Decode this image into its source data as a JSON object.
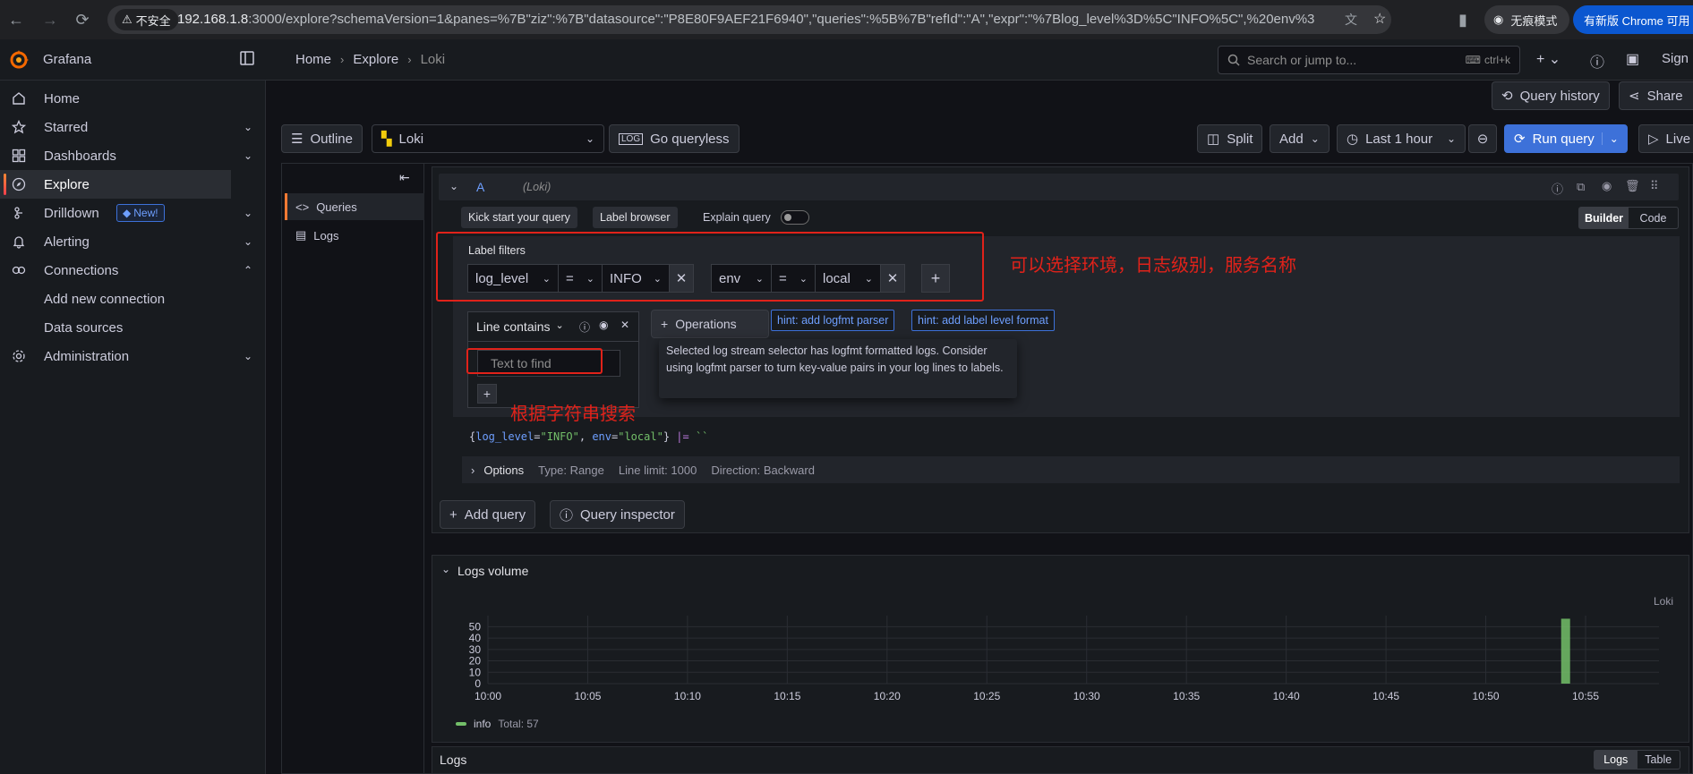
{
  "browser": {
    "insecure_label": "不安全",
    "url_host": "192.168.1.8",
    "url_rest": ":3000/explore?schemaVersion=1&panes=%7B\"ziz\":%7B\"datasource\":\"P8E80F9AEF21F6940\",\"queries\":%5B%7B\"refId\":\"A\",\"expr\":\"%7Blog_level%3D%5C\"INFO%5C\",%20env%3D%5C\"local...",
    "incognito_label": "无痕模式",
    "update_label": "有新版 Chrome 可用"
  },
  "topbar": {
    "brand": "Grafana",
    "breadcrumbs": [
      "Home",
      "Explore",
      "Loki"
    ],
    "search_placeholder": "Search or jump to...",
    "search_shortcut": "ctrl+k",
    "sign_in": "Sign"
  },
  "sidebar": {
    "items": [
      {
        "label": "Home"
      },
      {
        "label": "Starred"
      },
      {
        "label": "Dashboards"
      },
      {
        "label": "Explore"
      },
      {
        "label": "Drilldown",
        "badge": "New!"
      },
      {
        "label": "Alerting"
      },
      {
        "label": "Connections"
      },
      {
        "label": "Add new connection"
      },
      {
        "label": "Data sources"
      },
      {
        "label": "Administration"
      }
    ]
  },
  "toolbar": {
    "query_history": "Query history",
    "share": "Share",
    "outline": "Outline",
    "datasource": "Loki",
    "go_queryless": "Go queryless",
    "split": "Split",
    "add": "Add",
    "time_range": "Last 1 hour",
    "run_query": "Run query",
    "live": "Live"
  },
  "side_tabs": {
    "queries": "Queries",
    "logs": "Logs"
  },
  "query": {
    "ref_id": "A",
    "datasource_hint": "(Loki)",
    "kick_start": "Kick start your query",
    "label_browser": "Label browser",
    "explain_query": "Explain query",
    "mode_builder": "Builder",
    "mode_code": "Code",
    "label_filters_title": "Label filters",
    "filters": [
      {
        "label": "log_level",
        "op": "=",
        "value": "INFO"
      },
      {
        "label": "env",
        "op": "=",
        "value": "local"
      }
    ],
    "line_contains_title": "Line contains",
    "text_placeholder": "Text to find",
    "operations": "Operations",
    "hint_logfmt": "hint: add logfmt parser",
    "hint_level": "hint: add label level format",
    "tooltip": "Selected log stream selector has logfmt formatted logs. Consider using logfmt parser to turn key-value pairs in your log lines to labels.",
    "code_parts": [
      "{",
      "log_level",
      "=",
      "\"INFO\"",
      ", ",
      "env",
      "=",
      "\"local\"",
      "} ",
      "|=",
      " ``"
    ],
    "options_title": "Options",
    "options": [
      "Type: Range",
      "Line limit: 1000",
      "Direction: Backward"
    ],
    "add_query": "Add query",
    "query_inspector": "Query inspector"
  },
  "annotations": {
    "filters_note": "可以选择环境，日志级别，服务名称",
    "search_note": "根据字符串搜索"
  },
  "logs_volume": {
    "title": "Logs volume",
    "source": "Loki",
    "legend_total": "Total: 57"
  },
  "logs_panel": {
    "title": "Logs",
    "mode_logs": "Logs",
    "mode_table": "Table"
  },
  "colors": {
    "accent": "#3d71d9",
    "info_series": "#73bf69",
    "annotation": "#e0221a"
  },
  "chart_data": {
    "type": "bar",
    "x": [
      "10:00",
      "10:05",
      "10:10",
      "10:15",
      "10:20",
      "10:25",
      "10:30",
      "10:35",
      "10:40",
      "10:45",
      "10:50",
      "10:55"
    ],
    "ylim": [
      0,
      55
    ],
    "yticks": [
      0,
      10,
      20,
      30,
      40,
      50
    ],
    "series": [
      {
        "name": "info",
        "color": "#73bf69",
        "points": [
          {
            "x": "10:54",
            "y": 57
          }
        ]
      }
    ],
    "legend": "bottom-left",
    "grid": true
  }
}
